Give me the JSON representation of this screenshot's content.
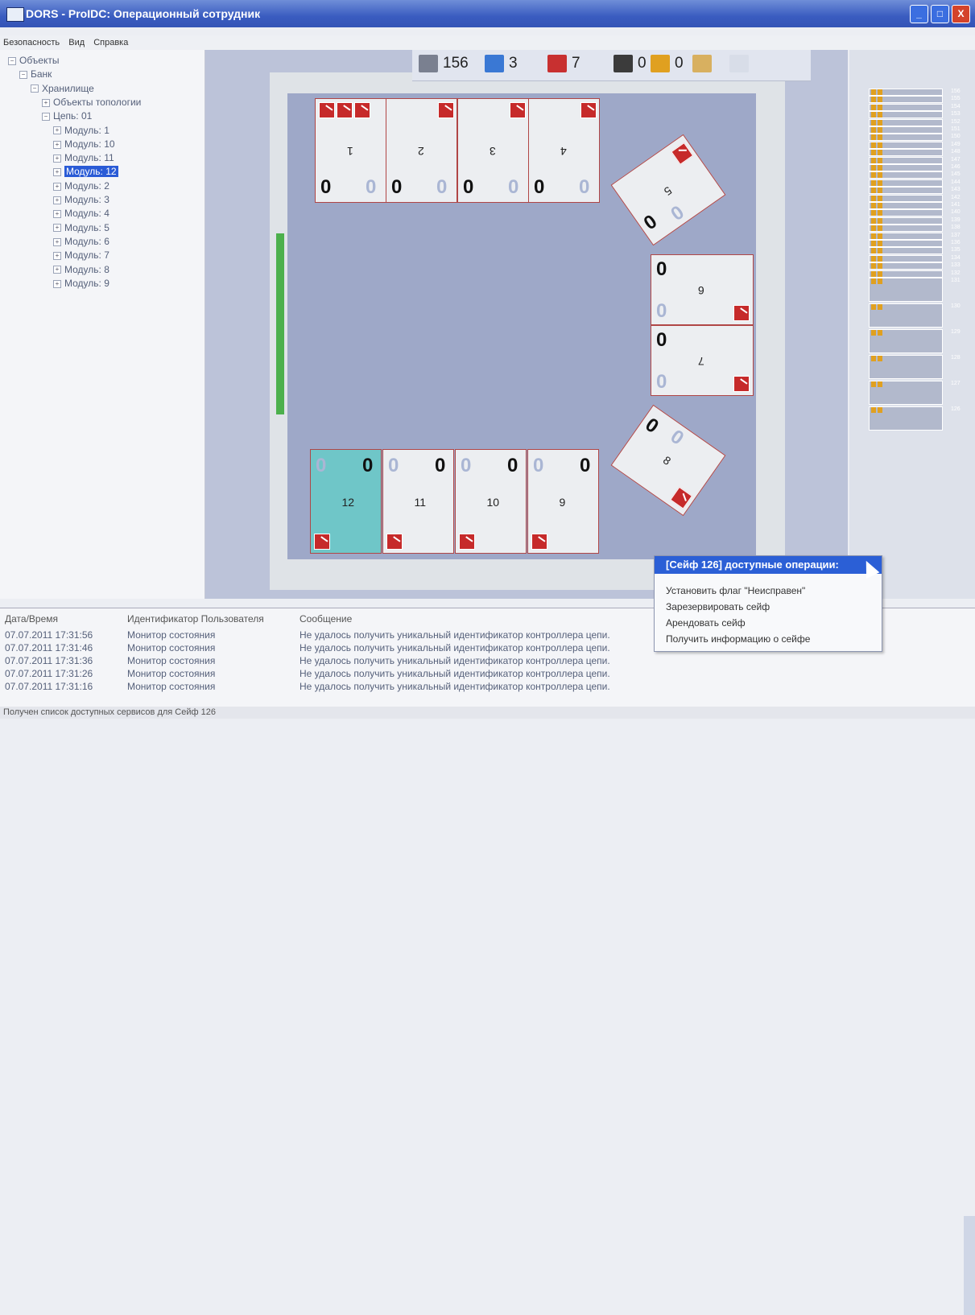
{
  "window": {
    "title": "DORS - ProIDC: Операционный сотрудник",
    "buttons": [
      "_",
      "□",
      "X"
    ]
  },
  "menu": [
    "Безопасность",
    "Вид",
    "Справка"
  ],
  "tree": [
    {
      "label": "Объекты",
      "level": 0,
      "exp": "−"
    },
    {
      "label": "Банк",
      "level": 1,
      "exp": "−"
    },
    {
      "label": "Хранилище",
      "level": 2,
      "exp": "−"
    },
    {
      "label": "Объекты топологии",
      "level": 3,
      "exp": "+"
    },
    {
      "label": "Цепь: 01",
      "level": 3,
      "exp": "−"
    },
    {
      "label": "Модуль: 1",
      "level": 4,
      "exp": "+"
    },
    {
      "label": "Модуль: 10",
      "level": 4,
      "exp": "+"
    },
    {
      "label": "Модуль: 11",
      "level": 4,
      "exp": "+"
    },
    {
      "label": "Модуль: 12",
      "level": 4,
      "exp": "+",
      "selected": true
    },
    {
      "label": "Модуль: 2",
      "level": 4,
      "exp": "+"
    },
    {
      "label": "Модуль: 3",
      "level": 4,
      "exp": "+"
    },
    {
      "label": "Модуль: 4",
      "level": 4,
      "exp": "+"
    },
    {
      "label": "Модуль: 5",
      "level": 4,
      "exp": "+"
    },
    {
      "label": "Модуль: 6",
      "level": 4,
      "exp": "+"
    },
    {
      "label": "Модуль: 7",
      "level": 4,
      "exp": "+"
    },
    {
      "label": "Модуль: 8",
      "level": 4,
      "exp": "+"
    },
    {
      "label": "Модуль: 9",
      "level": 4,
      "exp": "+"
    }
  ],
  "toolbar": [
    {
      "icon": "safe-icon",
      "value": "156",
      "color": "#7a8090"
    },
    {
      "icon": "letter-a-icon",
      "value": "3",
      "color": "#3a78d4"
    },
    {
      "icon": "broken-icon",
      "value": "7",
      "color": "#c83030"
    },
    {
      "icon": "door-icon",
      "value": "0",
      "color": "#3b3b3b"
    },
    {
      "icon": "lock-icon",
      "value": "0",
      "color": "#e0a020"
    },
    {
      "icon": "padlock-icon",
      "value": "",
      "color": "#d8b060"
    },
    {
      "icon": "search-icon",
      "value": "",
      "color": "#d8dde8"
    }
  ],
  "modules": {
    "top": [
      {
        "n": "1",
        "a": "0",
        "b": "0"
      },
      {
        "n": "2",
        "a": "0",
        "b": "0"
      },
      {
        "n": "3",
        "a": "0",
        "b": "0"
      },
      {
        "n": "4",
        "a": "0",
        "b": "0"
      }
    ],
    "right": [
      {
        "n": "5",
        "a": "0",
        "b": "0"
      },
      {
        "n": "6",
        "a": "0",
        "b": "0"
      },
      {
        "n": "7",
        "a": "0",
        "b": "0"
      },
      {
        "n": "8",
        "a": "0",
        "b": "0"
      }
    ],
    "bottom": [
      {
        "n": "12",
        "a": "0",
        "b": "0"
      },
      {
        "n": "11",
        "a": "0",
        "b": "0"
      },
      {
        "n": "10",
        "a": "0",
        "b": "0"
      },
      {
        "n": "9",
        "a": "0",
        "b": "0"
      }
    ]
  },
  "safe_list": [
    "156",
    "155",
    "154",
    "153",
    "152",
    "151",
    "150",
    "149",
    "148",
    "147",
    "146",
    "145",
    "144",
    "143",
    "142",
    "141",
    "140",
    "139",
    "138",
    "137",
    "136",
    "135",
    "134",
    "133",
    "132",
    "131",
    "130",
    "129",
    "128",
    "127",
    "126"
  ],
  "log": {
    "headers": [
      "Дата/Время",
      "Идентификатор Пользователя",
      "Сообщение"
    ],
    "rows": [
      [
        "07.07.2011 17:31:56",
        "Монитор состояния",
        "Не удалось получить уникальный идентификатор контроллера цепи."
      ],
      [
        "07.07.2011 17:31:46",
        "Монитор состояния",
        "Не удалось получить уникальный идентификатор контроллера цепи."
      ],
      [
        "07.07.2011 17:31:36",
        "Монитор состояния",
        "Не удалось получить уникальный идентификатор контроллера цепи."
      ],
      [
        "07.07.2011 17:31:26",
        "Монитор состояния",
        "Не удалось получить уникальный идентификатор контроллера цепи."
      ],
      [
        "07.07.2011 17:31:16",
        "Монитор состояния",
        "Не удалось получить уникальный идентификатор контроллера цепи."
      ]
    ]
  },
  "context_menu": {
    "header": "[Сейф 126] доступные операции:",
    "items": [
      "Установить флаг \"Неисправен\"",
      "Зарезервировать сейф",
      "Арендовать сейф",
      "Получить информацию о сейфе"
    ]
  },
  "status": "Получен список доступных сервисов для Сейф 126",
  "colors": {
    "selected_module": "#6fc6c8",
    "accent": "#2b5fd6"
  }
}
